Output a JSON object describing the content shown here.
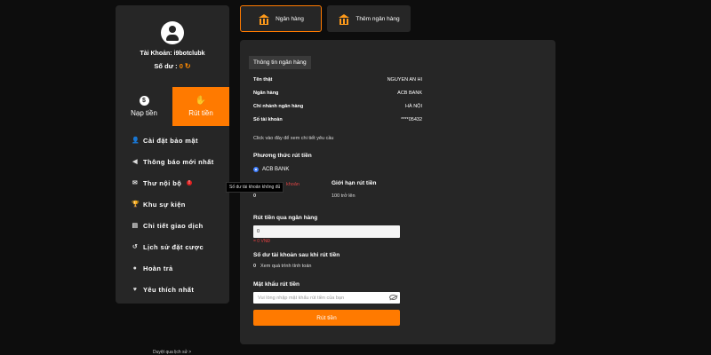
{
  "sidebar": {
    "account_label": "Tài Khoản: i9botclubk",
    "balance_label": "Số dư :",
    "balance_value": "0",
    "tabs": [
      {
        "label": "Nạp tiền",
        "icon": "dollar-coin-icon"
      },
      {
        "label": "Rút tiền",
        "icon": "hand-money-icon"
      }
    ],
    "menu": [
      {
        "label": "Cài đặt bảo mật",
        "icon": "user-lock-icon"
      },
      {
        "label": "Thông báo mới nhất",
        "icon": "megaphone-icon"
      },
      {
        "label": "Thư nội bộ",
        "icon": "envelope-icon",
        "badge": "!"
      },
      {
        "label": "Khu sự kiện",
        "icon": "trophy-icon"
      },
      {
        "label": "Chi tiết giao dịch",
        "icon": "clipboard-icon"
      },
      {
        "label": "Lịch sử đặt cược",
        "icon": "history-icon"
      },
      {
        "label": "Hoàn trả",
        "icon": "coin-icon"
      },
      {
        "label": "Yêu thích nhất",
        "icon": "heart-icon"
      }
    ],
    "history_link": "Duyệt qua lịch sử >"
  },
  "tooltip": "Số dư tài khoản không đủ",
  "top_tabs": [
    {
      "label": "Ngân hàng",
      "active": true
    },
    {
      "label": "Thêm ngân hàng",
      "active": false
    }
  ],
  "panel": {
    "section_title": "Thông tin ngân hàng",
    "info": [
      {
        "key": "Tên thật",
        "value": "NGUYEN AN HI"
      },
      {
        "key": "Ngân hàng",
        "value": "ACB BANK"
      },
      {
        "key": "Chi nhánh ngân hàng",
        "value": "HÀ NỘI"
      },
      {
        "key": "Số tài khoản",
        "value": "****05432"
      }
    ],
    "detail_hint": "Click vào đây để xem chi tiết yêu cầu",
    "method_title": "Phương thức rút tiền",
    "method_option": "ACB BANK",
    "remaining_label": "khoản",
    "remaining_value": "0",
    "limit_title": "Giới hạn rút tiền",
    "limit_value": "100 trở lên",
    "amount_title": "Rút tiền qua ngân hàng",
    "amount_value": "0",
    "amount_warning": "= 0 VNĐ",
    "after_title": "Số dư tài khoản sau khi rút tiền",
    "after_value": "0",
    "after_hint": "Xem quá trình tính toán",
    "password_title": "Mật khẩu rút tiền",
    "password_placeholder": "Vui lòng nhập mật khẩu rút tiền của bạn",
    "submit_label": "Rút tiền"
  },
  "colors": {
    "accent": "#ff7a00",
    "background": "#0d0d0d",
    "panel": "#262626"
  }
}
